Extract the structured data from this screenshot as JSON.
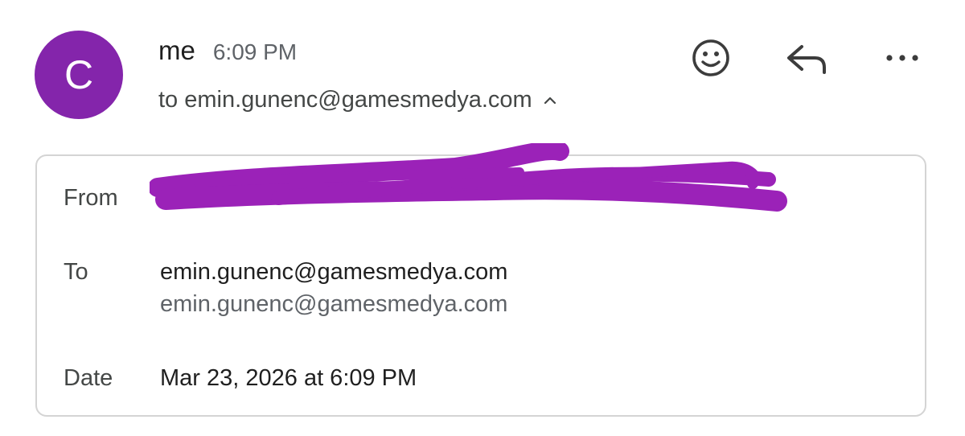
{
  "header": {
    "avatar_letter": "C",
    "sender": "me",
    "time": "6:09 PM",
    "recipient_summary": "to emin.gunenc@gamesmedya.com",
    "actions": {
      "emoji_icon": "emoji-icon",
      "reply_icon": "reply-icon",
      "more_icon": "more-options-icon"
    }
  },
  "details": {
    "from_label": "From",
    "to_label": "To",
    "to_values": [
      "emin.gunenc@gamesmedya.com",
      "emin.gunenc@gamesmedya.com"
    ],
    "date_label": "Date",
    "date_value": "Mar 23, 2026 at 6:09 PM"
  },
  "colors": {
    "avatar": "#8425ab",
    "redaction": "#9b22b8"
  }
}
